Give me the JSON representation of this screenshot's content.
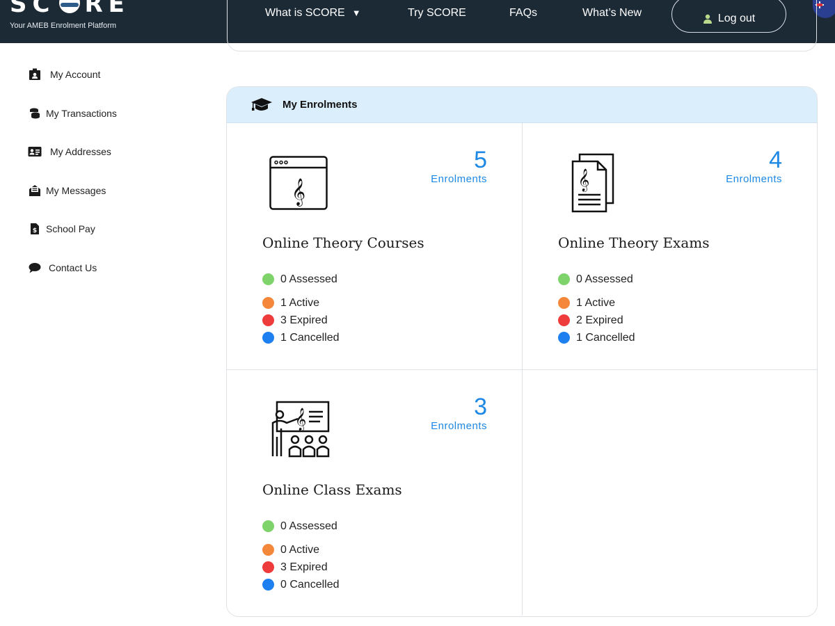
{
  "header": {
    "logo_pre": "SC",
    "logo_post": "RE",
    "tagline": "Your AMEB Enrolment Platform",
    "nav": [
      "What is SCORE",
      "Try SCORE",
      "FAQs",
      "What’s New"
    ],
    "nav_caret": "▼",
    "logout_label": "Log out",
    "bg_color": "#1c2a36"
  },
  "sidebar": {
    "items": [
      {
        "label": "My Account",
        "icon": "account-badge-icon"
      },
      {
        "label": "My Transactions",
        "icon": "coins-icon"
      },
      {
        "label": "My Addresses",
        "icon": "address-card-icon"
      },
      {
        "label": "My Messages",
        "icon": "envelope-icon"
      },
      {
        "label": "School Pay",
        "icon": "dollar-document-icon"
      },
      {
        "label": "Contact Us",
        "icon": "speech-bubble-icon"
      }
    ]
  },
  "enrolments": {
    "title": "My Enrolments",
    "cards": [
      {
        "title": "Online Theory Courses",
        "count": "5",
        "count_label": "Enrolments",
        "icon": "browser-treble-clef-icon",
        "stats": [
          {
            "label": "0 Assessed",
            "color": "#7ed36b"
          },
          {
            "label": "1 Active",
            "color": "#f5873b"
          },
          {
            "label": "3 Expired",
            "color": "#ee3b3b"
          },
          {
            "label": "1 Cancelled",
            "color": "#1e7ff0"
          }
        ]
      },
      {
        "title": "Online Theory Exams",
        "count": "4",
        "count_label": "Enrolments",
        "icon": "sheet-music-documents-icon",
        "stats": [
          {
            "label": "0 Assessed",
            "color": "#7ed36b"
          },
          {
            "label": "1 Active",
            "color": "#f5873b"
          },
          {
            "label": "2 Expired",
            "color": "#ee3b3b"
          },
          {
            "label": "1 Cancelled",
            "color": "#1e7ff0"
          }
        ]
      },
      {
        "title": "Online Class Exams",
        "count": "3",
        "count_label": "Enrolments",
        "icon": "teacher-class-icon",
        "stats": [
          {
            "label": "0 Assessed",
            "color": "#7ed36b"
          },
          {
            "label": "0 Active",
            "color": "#f5873b"
          },
          {
            "label": "3 Expired",
            "color": "#ee3b3b"
          },
          {
            "label": "0 Cancelled",
            "color": "#1e7ff0"
          }
        ]
      }
    ]
  }
}
